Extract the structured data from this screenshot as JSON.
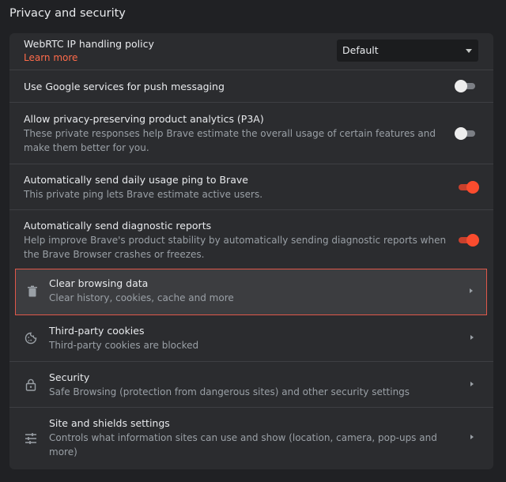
{
  "section": {
    "title": "Privacy and security"
  },
  "webrtc": {
    "title": "WebRTC IP handling policy",
    "link": "Learn more",
    "select_value": "Default"
  },
  "push": {
    "title": "Use Google services for push messaging",
    "enabled": false
  },
  "p3a": {
    "title": "Allow privacy-preserving product analytics (P3A)",
    "desc_line1": "These private responses help Brave estimate the overall usage of certain features and",
    "desc_line2": "make them better for you.",
    "enabled": false
  },
  "ping": {
    "title": "Automatically send daily usage ping to Brave",
    "desc": "This private ping lets Brave estimate active users.",
    "enabled": true
  },
  "diagnostic": {
    "title": "Automatically send diagnostic reports",
    "desc_line1": "Help improve Brave's product stability by automatically sending diagnostic reports when",
    "desc_line2": "the Brave Browser crashes or freezes.",
    "enabled": true
  },
  "nav": [
    {
      "title": "Clear browsing data",
      "desc": "Clear history, cookies, cache and more",
      "icon": "trash-icon",
      "highlighted": true
    },
    {
      "title": "Third-party cookies",
      "desc": "Third-party cookies are blocked",
      "icon": "cookie-icon"
    },
    {
      "title": "Security",
      "desc": "Safe Browsing (protection from dangerous sites) and other security settings",
      "icon": "lock-icon"
    },
    {
      "title": "Site and shields settings",
      "desc_line1": "Controls what information sites can use and show (location, camera, pop-ups and",
      "desc_line2": "more)",
      "icon": "sliders-icon"
    }
  ],
  "colors": {
    "background": "#202124",
    "card": "#2b2c2f",
    "accent": "#fa4c2e",
    "link": "#ff6b4a",
    "highlight_border": "#e0584a"
  }
}
